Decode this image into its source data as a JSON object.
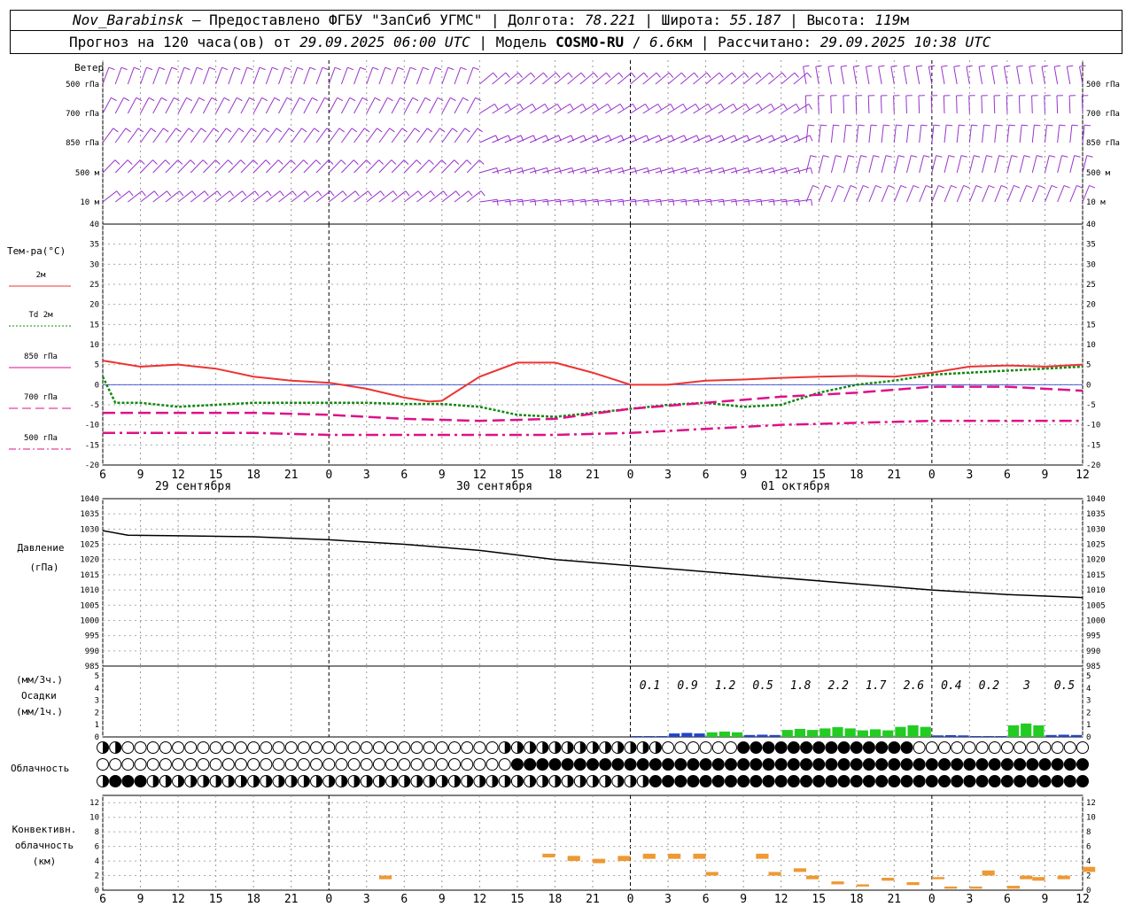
{
  "header": {
    "station": "Nov_Barabinsk",
    "provider": " — Предоставлено ФГБУ \"ЗапСиб УГМС\" | ",
    "lon_label": "Долгота: ",
    "lon": "78.221",
    "lat_label": " | Широта: ",
    "lat": "55.187",
    "alt_label": " | Высота: ",
    "alt": "119",
    "alt_unit": "м",
    "forecast_label": "Прогноз на 120 часа(ов) от ",
    "forecast_time": "29.09.2025 06:00 UTC",
    "model_label": " | Модель ",
    "model": "COSMO-RU",
    "res_sep": " / ",
    "res": "6.6",
    "res_unit": "км | Рассчитано: ",
    "calc_time": "29.09.2025 10:38 UTC"
  },
  "wind_panel": {
    "title": "Ветер",
    "levels": [
      "500 гПа",
      "700 гПа",
      "850 гПа",
      "500 м",
      "10  м"
    ],
    "barb_color": "#9933cc"
  },
  "temp_panel": {
    "title": "Тем-ра(°C)",
    "legend": [
      {
        "label": "2м",
        "color": "#ee3333",
        "style": "solid"
      },
      {
        "label": "Td  2м",
        "color": "#118811",
        "style": "dotted"
      },
      {
        "label": "850 гПа",
        "color": "#dd1188",
        "style": "solid"
      },
      {
        "label": "700 гПа",
        "color": "#dd1188",
        "style": "dash"
      },
      {
        "label": "500 гПа",
        "color": "#dd1188",
        "style": "dashdot"
      }
    ],
    "yticks": [
      "40",
      "35",
      "30",
      "25",
      "20",
      "15",
      "10",
      "5",
      "0",
      "-5",
      "-10",
      "-15",
      "-20"
    ]
  },
  "x_axis": {
    "hour_labels": [
      "6",
      "9",
      "12",
      "15",
      "18",
      "21",
      "0",
      "3",
      "6",
      "9",
      "12",
      "15",
      "18",
      "21",
      "0",
      "3",
      "6",
      "9",
      "12",
      "15",
      "18",
      "21",
      "0",
      "3",
      "6",
      "9",
      "12"
    ],
    "date_labels": [
      "29 сентября",
      "30 сентября",
      "01 октября"
    ]
  },
  "pressure_panel": {
    "title1": "Давление",
    "title2": "(гПа)",
    "yticks": [
      "1040",
      "1035",
      "1030",
      "1025",
      "1020",
      "1015",
      "1010",
      "1005",
      "1000",
      "995",
      "990",
      "985"
    ]
  },
  "precip_panel": {
    "label1": "(мм/3ч.)",
    "label2": "Осадки",
    "label3": "(мм/1ч.)",
    "yticks": [
      "5",
      "4",
      "3",
      "2",
      "1",
      "0"
    ],
    "totals_3h": [
      "0.1",
      "0.9",
      "1.2",
      "0.5",
      "1.8",
      "2.2",
      "1.7",
      "2.6",
      "0.4",
      "0.2",
      "3",
      "0.5"
    ]
  },
  "cloud_panel": {
    "title": "Облачность"
  },
  "conv_panel": {
    "title1": "Конвективн.",
    "title2": "облачность",
    "title3": "(км)",
    "yticks": [
      "12",
      "10",
      "8",
      "6",
      "4",
      "2",
      "0"
    ]
  },
  "chart_data": {
    "type": "line",
    "x_hours_from_start": "0..78 step 1 (start 29.09 06 UTC)",
    "series": [
      {
        "name": "2м",
        "unit": "°C",
        "x": [
          0,
          3,
          6,
          9,
          12,
          15,
          18,
          21,
          24,
          26,
          27,
          30,
          33,
          36,
          39,
          42,
          45,
          48,
          51,
          54,
          57,
          60,
          63,
          66,
          69,
          72,
          75,
          78
        ],
        "values": [
          6,
          4.5,
          5,
          4,
          2,
          1,
          0.5,
          -1,
          -3.2,
          -4.2,
          -4,
          2,
          5.5,
          5.5,
          3,
          0,
          0,
          1,
          1.3,
          1.7,
          2,
          2.2,
          2,
          3,
          4.5,
          4.8,
          4.5,
          5
        ]
      },
      {
        "name": "Td  2м",
        "unit": "°C",
        "x": [
          0,
          1,
          3,
          6,
          9,
          12,
          15,
          18,
          21,
          24,
          27,
          30,
          33,
          36,
          39,
          42,
          45,
          48,
          51,
          54,
          57,
          60,
          63,
          66,
          69,
          72,
          75,
          78
        ],
        "values": [
          2,
          -4.5,
          -4.5,
          -5.5,
          -5,
          -4.5,
          -4.5,
          -4.5,
          -4.5,
          -4.8,
          -4.8,
          -5.5,
          -7.5,
          -8,
          -7,
          -6,
          -5,
          -4.5,
          -5.5,
          -5,
          -2,
          0,
          1,
          2.5,
          3,
          3.5,
          4,
          4.5
        ]
      },
      {
        "name": "850 гПа",
        "unit": "°C",
        "x": [
          0,
          6,
          12,
          18,
          24,
          30,
          36,
          42,
          48,
          54,
          60,
          66,
          72,
          78
        ],
        "values": [
          -7,
          -7,
          -7,
          -7.5,
          -8.5,
          -9,
          -8.5,
          -6,
          -4.5,
          -3,
          -2,
          -0.5,
          -0.5,
          -1.5
        ]
      },
      {
        "name": "700 гПа",
        "unit": "°C",
        "x": [
          0,
          6,
          12,
          18,
          24,
          30,
          36,
          42,
          48,
          54,
          60,
          66,
          72,
          78
        ],
        "values": [
          -12,
          -12,
          -12,
          -12.5,
          -12.5,
          -12.5,
          -12.5,
          -12,
          -11,
          -10,
          -9.5,
          -9,
          -9,
          -9
        ]
      }
    ],
    "pressure": {
      "unit": "гПа",
      "x": [
        0,
        2,
        6,
        12,
        18,
        24,
        30,
        36,
        42,
        48,
        54,
        60,
        66,
        72,
        78
      ],
      "values": [
        1029.5,
        1028,
        1027.8,
        1027.5,
        1026.5,
        1025,
        1023,
        1020,
        1018,
        1016,
        1014,
        1012,
        1010,
        1008.5,
        1007.5
      ]
    },
    "precip_3h": {
      "unit": "мм/3ч.",
      "x": [
        42,
        45,
        48,
        51,
        54,
        57,
        60,
        63,
        66,
        69,
        72,
        75
      ],
      "values": [
        0.1,
        0.9,
        1.2,
        0.5,
        1.8,
        2.2,
        1.7,
        2.6,
        0.4,
        0.2,
        3,
        0.5
      ]
    },
    "ylim_temp": [
      -20,
      40
    ],
    "ylim_pressure": [
      985,
      1040
    ],
    "ylim_precip": [
      0,
      5
    ],
    "ylim_conv": [
      0,
      13
    ]
  }
}
